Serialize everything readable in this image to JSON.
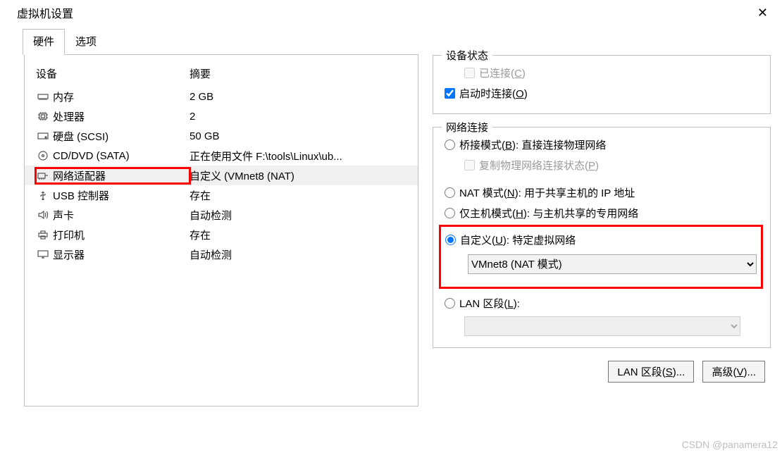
{
  "window": {
    "title": "虚拟机设置"
  },
  "tabs": {
    "hardware": "硬件",
    "options": "选项",
    "active": "hardware"
  },
  "device_headers": {
    "device": "设备",
    "summary": "摘要"
  },
  "devices": [
    {
      "icon": "memory-icon",
      "name": "内存",
      "summary": "2 GB"
    },
    {
      "icon": "cpu-icon",
      "name": "处理器",
      "summary": "2"
    },
    {
      "icon": "disk-icon",
      "name": "硬盘 (SCSI)",
      "summary": "50 GB"
    },
    {
      "icon": "cd-icon",
      "name": "CD/DVD (SATA)",
      "summary": "正在使用文件 F:\\tools\\Linux\\ub..."
    },
    {
      "icon": "nic-icon",
      "name": "网络适配器",
      "summary": "自定义 (VMnet8 (NAT)",
      "selected": true,
      "highlight": true
    },
    {
      "icon": "usb-icon",
      "name": "USB 控制器",
      "summary": "存在"
    },
    {
      "icon": "sound-icon",
      "name": "声卡",
      "summary": "自动检测"
    },
    {
      "icon": "printer-icon",
      "name": "打印机",
      "summary": "存在"
    },
    {
      "icon": "display-icon",
      "name": "显示器",
      "summary": "自动检测"
    }
  ],
  "status": {
    "legend": "设备状态",
    "connected": {
      "label": "已连接",
      "hotkey": "C",
      "checked": false,
      "enabled": false
    },
    "connect_on": {
      "label": "启动时连接",
      "hotkey": "O",
      "checked": true,
      "enabled": true
    }
  },
  "netconn": {
    "legend": "网络连接",
    "bridged": {
      "label": "桥接模式",
      "hotkey": "B",
      "suffix": ": 直接连接物理网络"
    },
    "replicate": {
      "label": "复制物理网络连接状态",
      "hotkey": "P",
      "enabled": false
    },
    "nat": {
      "label": "NAT 模式",
      "hotkey": "N",
      "suffix": ": 用于共享主机的 IP 地址"
    },
    "hostonly": {
      "label": "仅主机模式",
      "hotkey": "H",
      "suffix": ": 与主机共享的专用网络"
    },
    "custom": {
      "label": "自定义",
      "hotkey": "U",
      "suffix": ": 特定虚拟网络"
    },
    "custom_value": "VMnet8 (NAT 模式)",
    "lan": {
      "label": "LAN 区段",
      "hotkey": "L",
      "value": ""
    }
  },
  "buttons": {
    "lan_segments": {
      "label": "LAN 区段",
      "hotkey": "S",
      "suffix": "..."
    },
    "advanced": {
      "label": "高级",
      "hotkey": "V",
      "suffix": "..."
    }
  },
  "watermark": "CSDN @panamera12"
}
